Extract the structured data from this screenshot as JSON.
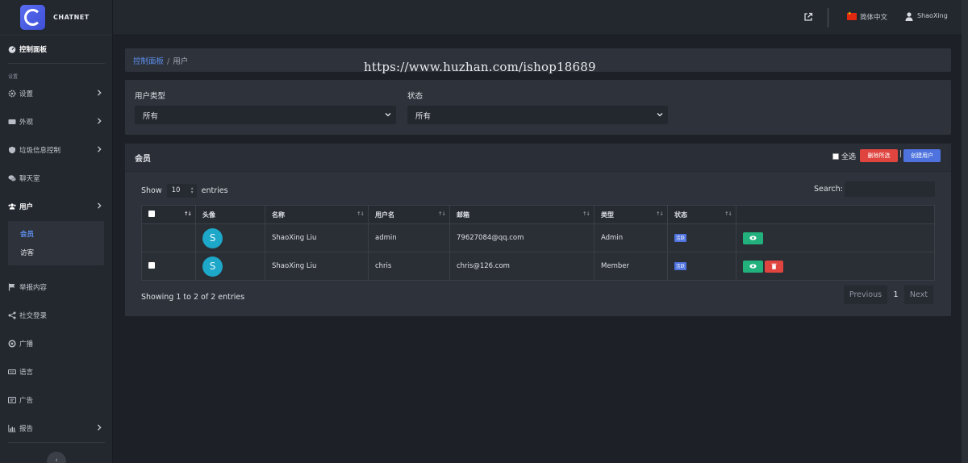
{
  "brand": {
    "name": "CHATNET"
  },
  "topbar": {
    "language": "简体中文",
    "user": "ShaoXing"
  },
  "sidebar": {
    "dashboard": "控制面板",
    "section_settings": "设置",
    "items": [
      {
        "label": "设置",
        "icon": "gear-icon",
        "has_chevron": true
      },
      {
        "label": "外观",
        "icon": "display-icon",
        "has_chevron": true
      },
      {
        "label": "垃圾信息控制",
        "icon": "shield-icon",
        "has_chevron": true
      },
      {
        "label": "聊天室",
        "icon": "chat-icon",
        "has_chevron": false
      },
      {
        "label": "用户",
        "icon": "users-icon",
        "has_chevron": true,
        "active": true
      },
      {
        "label": "举报内容",
        "icon": "flag-icon",
        "has_chevron": false
      },
      {
        "label": "社交登录",
        "icon": "share-icon",
        "has_chevron": false
      },
      {
        "label": "广播",
        "icon": "broadcast-icon",
        "has_chevron": false
      },
      {
        "label": "语言",
        "icon": "keyboard-icon",
        "has_chevron": false
      },
      {
        "label": "广告",
        "icon": "ad-icon",
        "has_chevron": false
      },
      {
        "label": "报告",
        "icon": "chart-icon",
        "has_chevron": true
      }
    ],
    "submenu": [
      "会员",
      "访客"
    ]
  },
  "breadcrumb": {
    "home": "控制面板",
    "separator": "/",
    "current": "用户"
  },
  "watermark": "https://www.huzhan.com/ishop18689",
  "filters": {
    "user_type_label": "用户类型",
    "user_type_value": "所有",
    "status_label": "状态",
    "status_value": "所有"
  },
  "members": {
    "title": "会员",
    "select_all": "全选",
    "delete_selected": "删除所选",
    "bar": "|",
    "create_user": "创建用户",
    "show": "Show",
    "page_length": "10",
    "entries": "entries",
    "search_label": "Search:",
    "columns": [
      "头像",
      "名称",
      "用户名",
      "邮箱",
      "类型",
      "状态"
    ],
    "rows": [
      {
        "avatar": "S",
        "name": "ShaoXing Liu",
        "username": "admin",
        "email": "79627084@qq.com",
        "type": "Admin",
        "status": "活跃",
        "has_checkbox": false,
        "has_delete": false
      },
      {
        "avatar": "S",
        "name": "ShaoXing Liu",
        "username": "chris",
        "email": "chris@126.com",
        "type": "Member",
        "status": "活跃",
        "has_checkbox": true,
        "has_delete": true
      }
    ],
    "info": "Showing 1 to 2 of 2 entries",
    "pager": {
      "previous": "Previous",
      "current": "1",
      "next": "Next"
    }
  },
  "colors": {
    "accent": "#4e73df",
    "danger": "#e0443f",
    "success": "#22b07d",
    "avatar": "#1da7c8"
  }
}
